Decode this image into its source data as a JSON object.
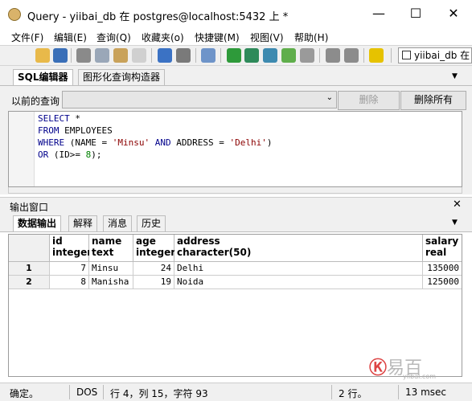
{
  "window": {
    "title": "Query - yiibai_db 在  postgres@localhost:5432 上 *",
    "minimize": "—",
    "maximize": "☐",
    "close": "✕"
  },
  "menu": [
    "文件(F)",
    "编辑(E)",
    "查询(Q)",
    "收藏夹(o)",
    "快捷键(M)",
    "视图(V)",
    "帮助(H)"
  ],
  "toolbar": {
    "icons": [
      "open-icon",
      "save-icon",
      "cut-icon",
      "copy-icon",
      "paste-icon",
      "clear-icon",
      "undo-icon",
      "redo-icon",
      "find-icon",
      "execute-icon",
      "execute-pgscript-icon",
      "execute-to-file-icon",
      "explain-icon",
      "stop-icon",
      "commit-icon",
      "rollback-icon",
      "help-icon"
    ],
    "db_selector": "yiibai_db 在"
  },
  "query_tabs": [
    "SQL编辑器",
    "图形化查询构造器"
  ],
  "previous_queries": {
    "label": "以前的查询",
    "value": "",
    "delete_button": "删除",
    "delete_all_button": "删除所有"
  },
  "sql": {
    "lines": [
      "SELECT *",
      "FROM EMPLOYEES",
      "WHERE (NAME = 'Minsu' AND ADDRESS = 'Delhi')",
      "OR (ID>= 8);"
    ]
  },
  "output": {
    "title": "输出窗口",
    "tabs": [
      "数据输出",
      "解释",
      "消息",
      "历史"
    ],
    "columns": [
      {
        "name": "id",
        "type": "integer"
      },
      {
        "name": "name",
        "type": "text"
      },
      {
        "name": "age",
        "type": "integer"
      },
      {
        "name": "address",
        "type": "character(50)"
      },
      {
        "name": "salary",
        "type": "real"
      }
    ],
    "rows": [
      {
        "num": "1",
        "id": "7",
        "name": "Minsu",
        "age": "24",
        "address": "Delhi",
        "salary": "135000"
      },
      {
        "num": "2",
        "id": "8",
        "name": "Manisha",
        "age": "19",
        "address": "Noida",
        "salary": "125000"
      }
    ]
  },
  "status": {
    "state": "确定。",
    "line_ending": "DOS",
    "position": "行 4，列 15，字符 93",
    "rows": "2 行。",
    "time": "13 msec"
  },
  "watermark": {
    "text": "易百",
    "url": "yiibai.com"
  },
  "colors": {
    "keyword": "#00008b",
    "string": "#8b0000",
    "number": "#008000"
  }
}
